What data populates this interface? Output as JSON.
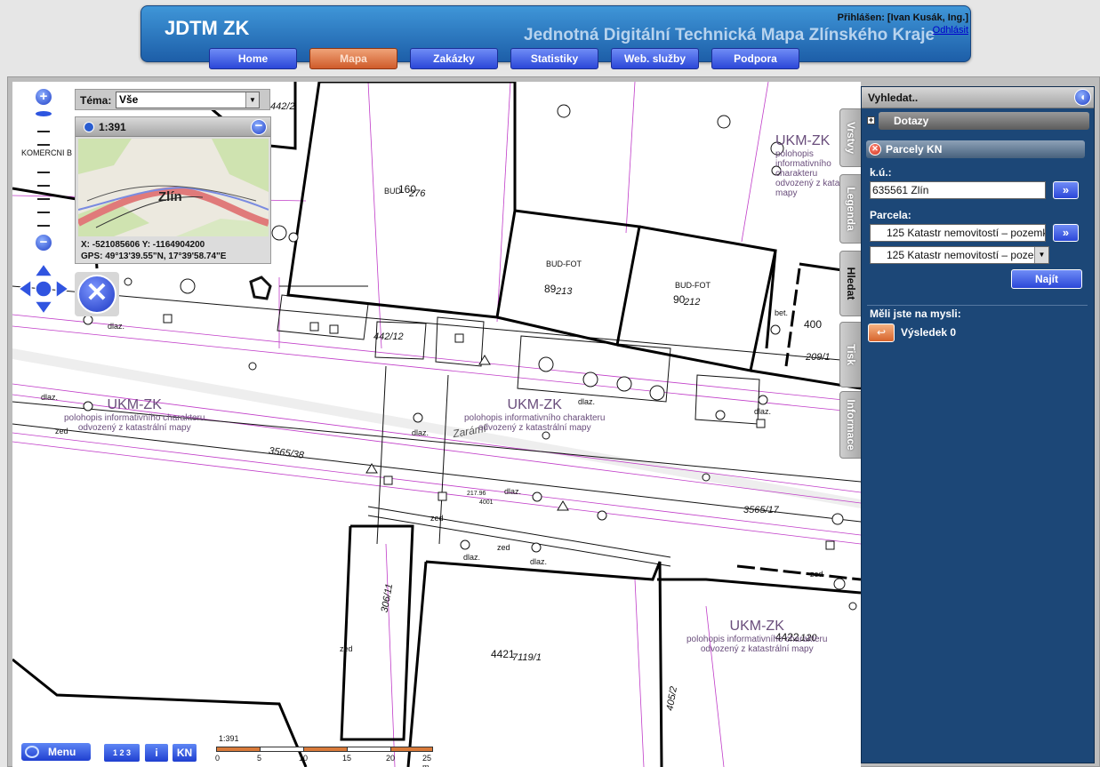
{
  "header": {
    "app_title": "JDTM ZK",
    "subtitle": "Jednotná Digitální Technická Mapa Zlínského Kraje",
    "login_text": "Přihlášen: [Ivan Kusák, Ing.]",
    "logout": "Odhlásit",
    "nav": [
      {
        "label": "Home",
        "active": false
      },
      {
        "label": "Mapa",
        "active": true
      },
      {
        "label": "Zakázky",
        "active": false
      },
      {
        "label": "Statistiky",
        "active": false
      },
      {
        "label": "Web. služby",
        "active": false
      },
      {
        "label": "Podpora",
        "active": false
      }
    ]
  },
  "theme": {
    "label": "Téma:",
    "value": "Vše"
  },
  "overview": {
    "scale": "1:391",
    "place": "Zlín",
    "coords_xy": "X: -521085606 Y: -1164904200",
    "coords_gps": "GPS: 49°13'39.55\"N, 17°39'58.74\"E"
  },
  "zoom": {
    "caption": "KOMERCNI B"
  },
  "toolbar": {
    "menu": "Menu",
    "numbers": "1 2 3",
    "info": "i",
    "kn": "KN"
  },
  "scale_bar": {
    "label": "1:391",
    "ticks": [
      "0",
      "5",
      "10",
      "15",
      "20",
      "25 m"
    ]
  },
  "side_tabs": [
    {
      "label": "Vrstvy",
      "active": false
    },
    {
      "label": "Legenda",
      "active": false
    },
    {
      "label": "Hledat",
      "active": true
    },
    {
      "label": "Tisk",
      "active": false
    },
    {
      "label": "Informace",
      "active": false
    }
  ],
  "panel": {
    "title": "Vyhledat..",
    "queries": "Dotazy",
    "parcels_title": "Parcely KN",
    "ku_label": "k.ú.:",
    "ku_value": "635561 Zlín",
    "parcel_label": "Parcela:",
    "parcel_value": "125 Katastr nemovitostí – pozemky",
    "parcel_select": "125 Katastr nemovitostí – pozemky",
    "go": "»",
    "find": "Najít",
    "suggest_label": "Měli jste na mysli:",
    "result": "Výsledek 0"
  },
  "map_labels": {
    "parcels": [
      "442/2",
      "160",
      "276",
      "89",
      "213",
      "90",
      "212",
      "400",
      "209/1",
      "442/12",
      "3565/38",
      "3565/17",
      "306/11",
      "4421",
      "7119/1",
      "405/2",
      "4422",
      "120",
      "217.96",
      "4001"
    ],
    "buildings": [
      "BUD-FOT",
      "BUD-FOT",
      "BUD"
    ],
    "surfaces": [
      "dlaz.",
      "dlaz.",
      "dlaz.",
      "dlaz.",
      "dlaz.",
      "dlaz.",
      "dlaz.",
      "dlaz.",
      "zed",
      "zed",
      "zed",
      "zed",
      "bet.",
      "zed"
    ],
    "street": "Zarámí",
    "ukm": {
      "title": "UKM-ZK",
      "line1": "polohopis informativního charakteru",
      "line2": "odvozený z katastrální mapy"
    }
  }
}
